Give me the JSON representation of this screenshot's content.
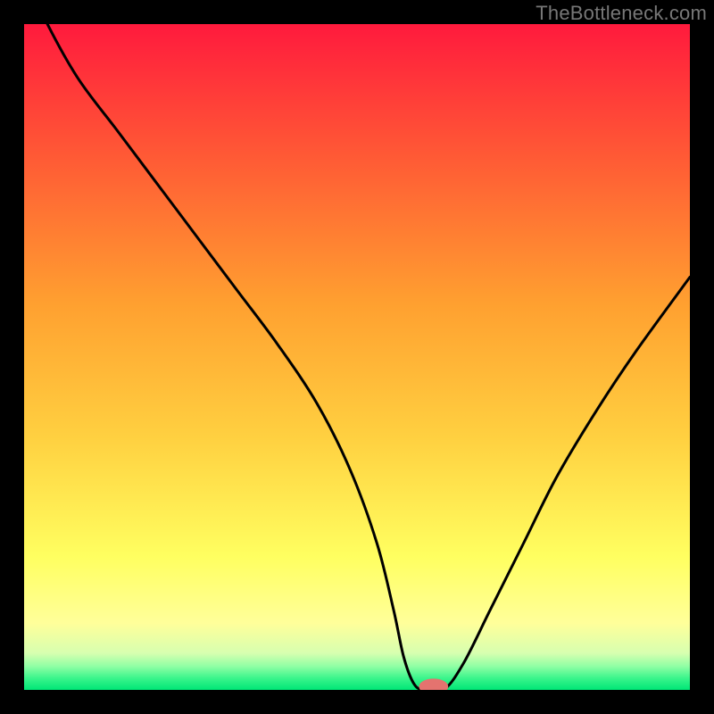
{
  "watermark": "TheBottleneck.com",
  "colors": {
    "frame_bg": "#000000",
    "grad_top": "#ff1a3d",
    "grad_mid_upper": "#ff6a2f",
    "grad_mid": "#ffb030",
    "grad_mid_lower": "#ffe040",
    "grad_yellow_pale": "#ffff9a",
    "grad_green_pale": "#a8ffb4",
    "grad_green": "#00e676",
    "curve": "#000000",
    "marker_fill": "#e4736f",
    "marker_stroke": "#e4736f",
    "watermark": "#777777"
  },
  "chart_data": {
    "type": "line",
    "title": "",
    "xlabel": "",
    "ylabel": "",
    "xlim": [
      0,
      100
    ],
    "ylim": [
      0,
      100
    ],
    "grid": false,
    "legend": false,
    "annotations": [
      "TheBottleneck.com"
    ],
    "series": [
      {
        "name": "bottleneck-curve",
        "x": [
          0,
          3,
          8,
          14,
          20,
          26,
          32,
          38,
          44,
          49,
          53,
          55.5,
          57,
          58.5,
          60,
          63,
          66,
          70,
          75,
          80,
          86,
          92,
          100
        ],
        "y": [
          108,
          101,
          92,
          84,
          76,
          68,
          60,
          52,
          43,
          33,
          22,
          12,
          5,
          1,
          0,
          0,
          4,
          12,
          22,
          32,
          42,
          51,
          62
        ]
      }
    ],
    "marker": {
      "x": 61.5,
      "y": 0.5,
      "rx": 2.2,
      "ry": 1.2
    },
    "gradient_stops": [
      {
        "offset": 0.0,
        "color": "#ff1a3d"
      },
      {
        "offset": 0.2,
        "color": "#ff5a35"
      },
      {
        "offset": 0.42,
        "color": "#ffa030"
      },
      {
        "offset": 0.62,
        "color": "#ffd040"
      },
      {
        "offset": 0.8,
        "color": "#ffff60"
      },
      {
        "offset": 0.9,
        "color": "#ffff9a"
      },
      {
        "offset": 0.945,
        "color": "#d7ffb0"
      },
      {
        "offset": 0.965,
        "color": "#8effa4"
      },
      {
        "offset": 0.982,
        "color": "#3cf58c"
      },
      {
        "offset": 1.0,
        "color": "#00e676"
      }
    ]
  }
}
